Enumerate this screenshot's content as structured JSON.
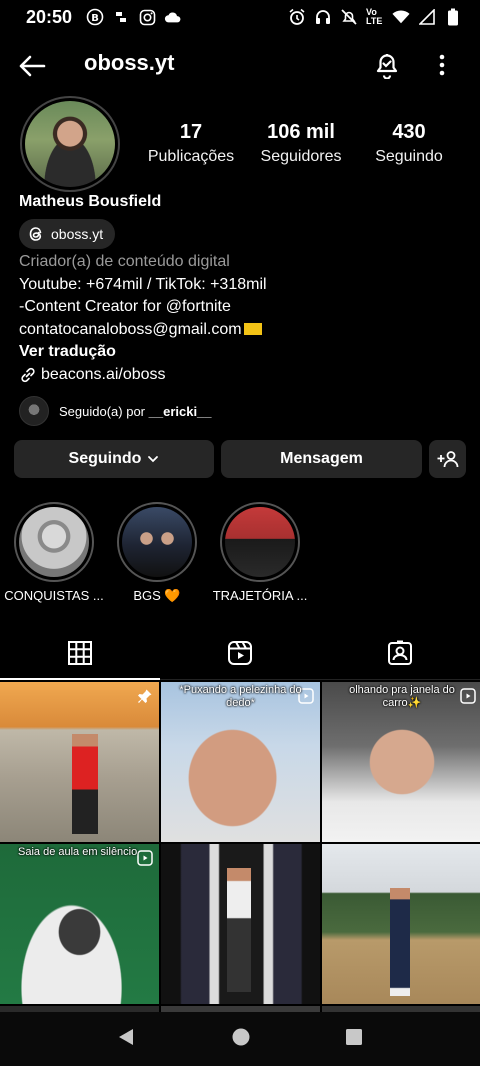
{
  "status_bar": {
    "time": "20:50",
    "network": "Vo LTE"
  },
  "top_bar": {
    "username": "oboss.yt"
  },
  "profile": {
    "display_name": "Matheus Bousfield",
    "threads_handle": "oboss.yt",
    "stats": [
      {
        "value": "17",
        "label": "Publicações"
      },
      {
        "value": "106 mil",
        "label": "Seguidores"
      },
      {
        "value": "430",
        "label": "Seguindo"
      }
    ],
    "bio": {
      "category": "Criador(a) de conteúdo digital",
      "lines": [
        "Youtube: +674mil / TikTok: +318mil",
        "-Content Creator for @fortnite",
        "contatocanaloboss@gmail.com"
      ],
      "translate": "Ver tradução",
      "link": "beacons.ai/oboss"
    },
    "followed_by": {
      "prefix": "Seguido(a) por",
      "user": "__ericki__"
    }
  },
  "actions": {
    "following_label": "Seguindo",
    "message_label": "Mensagem"
  },
  "highlights": [
    {
      "label": "CONQUISTAS ..."
    },
    {
      "label": "BGS 🧡"
    },
    {
      "label": "TRAJETÓRIA ..."
    }
  ],
  "tabs": [
    "grid-icon",
    "reels-icon",
    "tagged-icon"
  ],
  "posts": [
    {
      "caption": ""
    },
    {
      "caption": "*Puxando a pelezinha do dedo*"
    },
    {
      "caption": "olhando pra janela do carro✨"
    },
    {
      "caption": "Saia de aula em silêncio"
    },
    {
      "caption": ""
    },
    {
      "caption": ""
    }
  ],
  "colors": {
    "background": "#000000",
    "button": "#262626",
    "muted_text": "#9a9a9a"
  }
}
